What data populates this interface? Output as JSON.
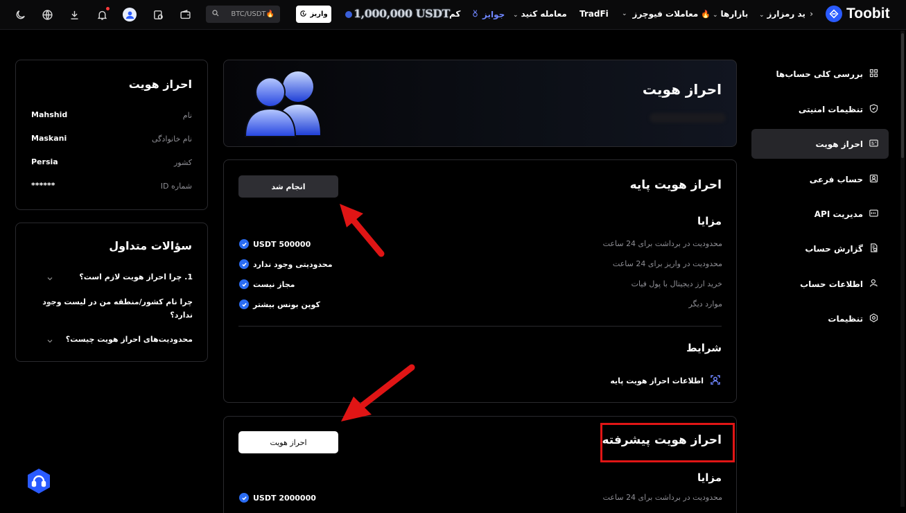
{
  "header": {
    "brand": "Toobit",
    "nav": [
      {
        "label": "ید رمزارز",
        "caret": true
      },
      {
        "label": "بازارها",
        "caret": true
      },
      {
        "label": "معاملات فیوچرز",
        "caret": true
      },
      {
        "label": "TradFi",
        "caret": false
      },
      {
        "label": "معامله کنید",
        "caret": true
      },
      {
        "label": "جوایز",
        "caret": false
      },
      {
        "label": "کم",
        "caret": false
      }
    ],
    "promo_text": "1,000,000 USDT",
    "deposit_label": "واریز",
    "search_placeholder": "BTC/USDT",
    "colors": {
      "accent": "#2a5bff",
      "rewards": "#6f86ff",
      "badge": "#ff3b3b"
    }
  },
  "sidebar": {
    "items": [
      {
        "label": "بررسی کلی حساب‌ها",
        "icon": "grid-icon",
        "active": false
      },
      {
        "label": "تنظیمات امنیتی",
        "icon": "shield-icon",
        "active": false
      },
      {
        "label": "احراز هویت",
        "icon": "id-card-icon",
        "active": true
      },
      {
        "label": "حساب فرعی",
        "icon": "sub-account-icon",
        "active": false
      },
      {
        "label": "مدیریت API",
        "icon": "api-icon",
        "active": false
      },
      {
        "label": "گزارش حساب",
        "icon": "report-icon",
        "active": false
      },
      {
        "label": "اطلاعات حساب",
        "icon": "user-info-icon",
        "active": false
      },
      {
        "label": "تنظیمات",
        "icon": "settings-icon",
        "active": false
      }
    ]
  },
  "hero": {
    "title": "احراز هویت"
  },
  "basic": {
    "title": "احراز هویت پایه",
    "status_button": "انجام شد",
    "benefits_title": "مزایا",
    "benefits": [
      {
        "label": "محدودیت در برداشت برای 24 ساعت",
        "value": "USDT 500000"
      },
      {
        "label": "محدودیت در واریز برای 24 ساعت",
        "value": "محدودیتی وجود ندارد"
      },
      {
        "label": "خرید ارز دیجیتال با پول فیات",
        "value": "مجاز نیست"
      },
      {
        "label": "موارد دیگر",
        "value": "کوپن بونس بیشتر"
      }
    ],
    "conditions_title": "شرایط",
    "condition_item": "اطلاعات احراز هویت پایه"
  },
  "advanced": {
    "title": "احراز هویت پیشرفته",
    "action_button": "احراز هویت",
    "benefits_title": "مزایا",
    "benefits": [
      {
        "label": "محدودیت در برداشت برای 24 ساعت",
        "value": "USDT 2000000"
      }
    ]
  },
  "identity_card": {
    "title": "احراز هویت",
    "rows": [
      {
        "label": "نام",
        "value": "Mahshid"
      },
      {
        "label": "نام خانوادگی",
        "value": "Maskani"
      },
      {
        "label": "کشور",
        "value": "Persia"
      },
      {
        "label": "شماره ID",
        "value": "******"
      }
    ]
  },
  "faq": {
    "title": "سؤالات متداول",
    "items": [
      "1. چرا احراز هویت لازم است؟",
      "چرا نام کشور/منطقه من در لیست وجود ندارد؟",
      "محدودیت‌های احراز هویت چیست؟"
    ]
  }
}
